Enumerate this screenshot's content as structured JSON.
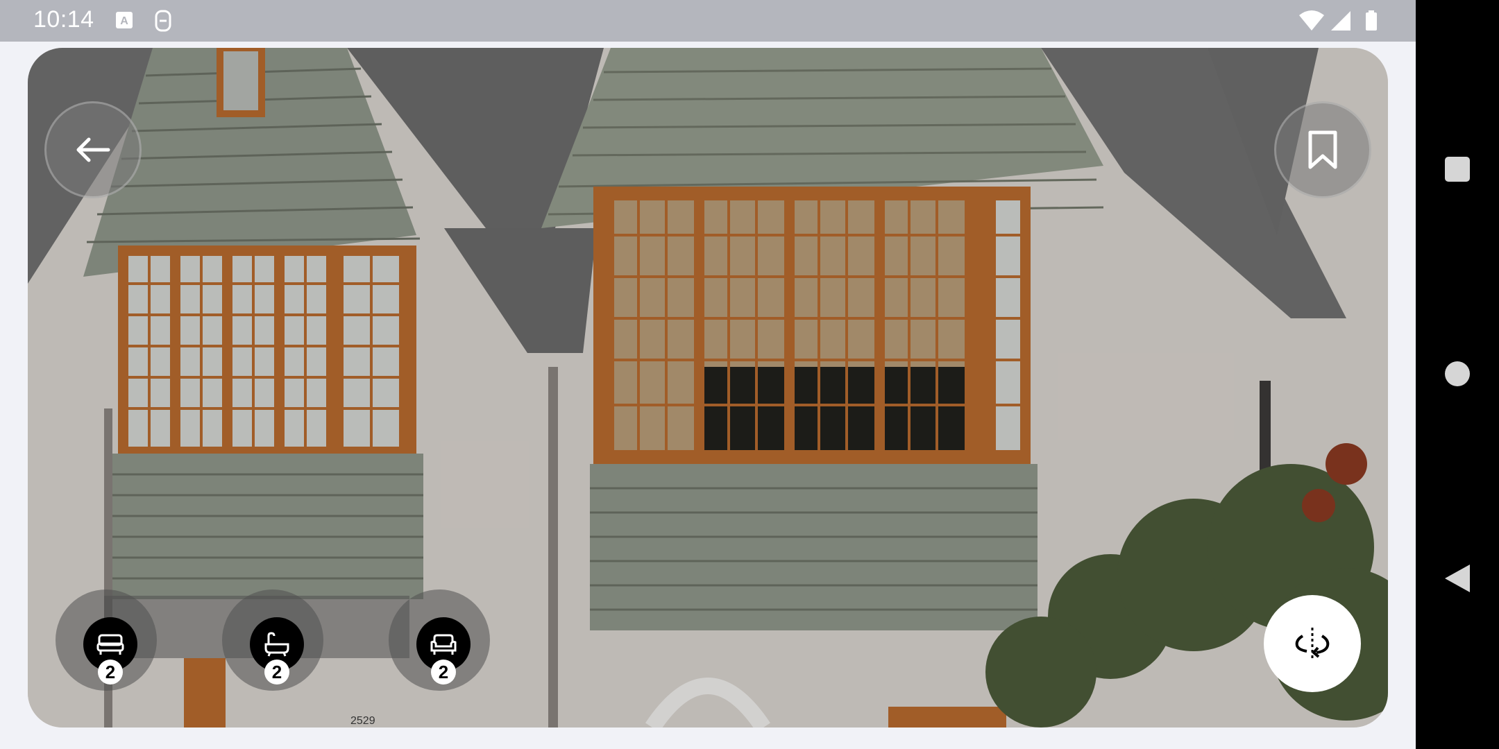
{
  "status_bar": {
    "time": "10:14",
    "icons": [
      "text-a-icon",
      "sim-toolkit-icon",
      "wifi-icon",
      "signal-icon",
      "battery-icon"
    ]
  },
  "photo": {
    "house_number": "2529"
  },
  "actions": {
    "back_icon": "arrow-left-icon",
    "bookmark_icon": "bookmark-icon",
    "view360_icon": "rotate-360-icon"
  },
  "features": [
    {
      "icon": "bed-icon",
      "count": "2"
    },
    {
      "icon": "bathtub-icon",
      "count": "2"
    },
    {
      "icon": "sofa-icon",
      "count": "2"
    }
  ],
  "colors": {
    "status_bar": "#b4b6bd",
    "background": "#f1f2f7",
    "siding": "#8f978a",
    "window_frame": "#b86a2e"
  }
}
